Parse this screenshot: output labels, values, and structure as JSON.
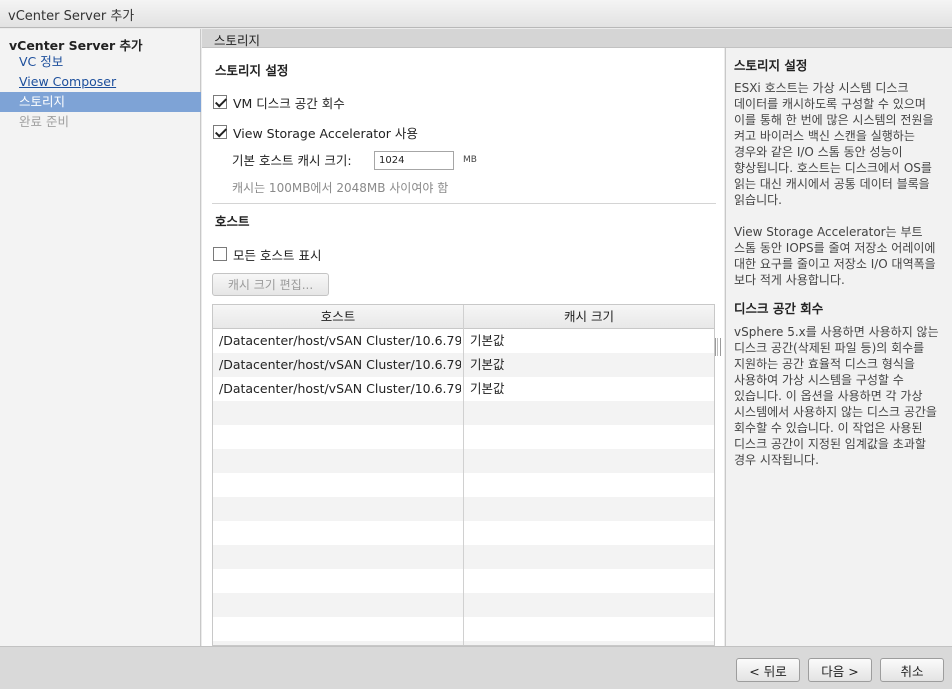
{
  "window": {
    "title": "vCenter Server 추가"
  },
  "sidebar": {
    "header": "vCenter Server 추가",
    "items": [
      {
        "label": "VC 정보"
      },
      {
        "label": "View Composer"
      },
      {
        "label": "스토리지"
      },
      {
        "label": "완료 준비"
      }
    ]
  },
  "section": {
    "title": "스토리지"
  },
  "storage": {
    "heading": "스토리지 설정",
    "reclaim_label": "VM 디스크 공간 회수",
    "reclaim_checked": true,
    "accelerator_label": "View Storage Accelerator 사용",
    "accelerator_checked": true,
    "cache_size_label": "기본 호스트 캐시 크기:",
    "cache_size_value": "1024",
    "cache_unit": "MB",
    "cache_hint": "캐시는 100MB에서 2048MB 사이여야 함"
  },
  "hosts": {
    "heading": "호스트",
    "show_all_label": "모든 호스트 표시",
    "show_all_checked": false,
    "edit_button": "캐시 크기 편집...",
    "columns": [
      "호스트",
      "캐시 크기"
    ],
    "rows": [
      {
        "host": "/Datacenter/host/vSAN Cluster/10.6.79",
        "cache": "기본값"
      },
      {
        "host": "/Datacenter/host/vSAN Cluster/10.6.79",
        "cache": "기본값"
      },
      {
        "host": "/Datacenter/host/vSAN Cluster/10.6.79",
        "cache": "기본값"
      }
    ]
  },
  "help": {
    "title1": "스토리지 설정",
    "para1": "ESXi 호스트는 가상 시스템 디스크 데이터를 캐시하도록 구성할 수 있으며 이를 통해 한 번에 많은 시스템의 전원을 켜고 바이러스 백신 스캔을 실행하는 경우와 같은 I/O 스톰 동안 성능이 향상됩니다. 호스트는 디스크에서 OS를 읽는 대신 캐시에서 공통 데이터 블록을 읽습니다.",
    "para2": "View Storage Accelerator는 부트 스톰 동안 IOPS를 줄여 저장소 어레이에 대한 요구를 줄이고 저장소 I/O 대역폭을 보다 적게 사용합니다.",
    "title2": "디스크 공간 회수",
    "para3": "vSphere 5.x를 사용하면 사용하지 않는 디스크 공간(삭제된 파일 등)의 회수를 지원하는 공간 효율적 디스크 형식을 사용하여 가상 시스템을 구성할 수 있습니다. 이 옵션을 사용하면 각 가상 시스템에서 사용하지 않는 디스크 공간을 회수할 수 있습니다. 이 작업은 사용된 디스크 공간이 지정된 임계값을 초과할 경우 시작됩니다."
  },
  "footer": {
    "back": "< 뒤로",
    "next": "다음 >",
    "cancel": "취소"
  }
}
